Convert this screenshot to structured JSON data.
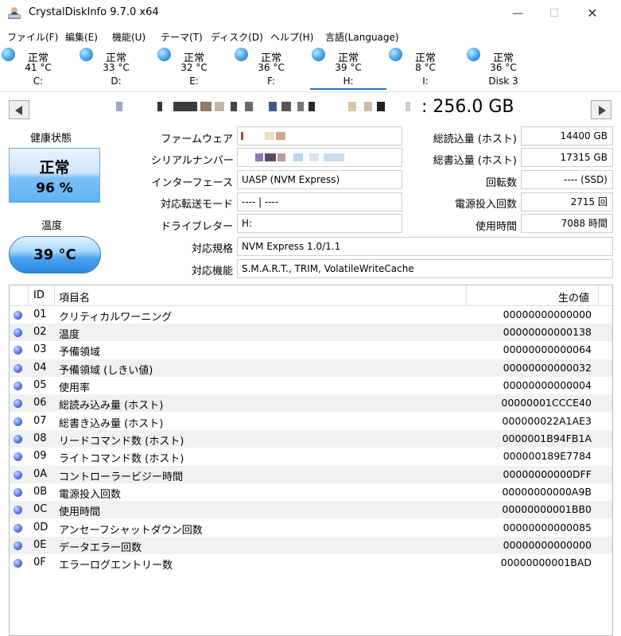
{
  "window": {
    "title": "CrystalDiskInfo 9.7.0 x64",
    "minimize": "—",
    "maximize": "☐",
    "close": "✕"
  },
  "menu": [
    "ファイル(F)",
    "編集(E)",
    "機能(U)",
    "テーマ(T)",
    "ディスク(D)",
    "ヘルプ(H)",
    "言語(Language)"
  ],
  "drives": [
    {
      "status": "正常",
      "temp": "41 °C",
      "letter": "C:"
    },
    {
      "status": "正常",
      "temp": "33 °C",
      "letter": "D:"
    },
    {
      "status": "正常",
      "temp": "32 °C",
      "letter": "E:"
    },
    {
      "status": "正常",
      "temp": "36 °C",
      "letter": "F:"
    },
    {
      "status": "正常",
      "temp": "39 °C",
      "letter": "H:"
    },
    {
      "status": "正常",
      "temp": "8 °C",
      "letter": "I:"
    },
    {
      "status": "正常",
      "temp": "36 °C",
      "letter": "Disk 3"
    }
  ],
  "model": {
    "capacity": ": 256.0 GB"
  },
  "health": {
    "label": "健康状態",
    "status": "正常",
    "percent": "96 %"
  },
  "temperature": {
    "label": "温度",
    "value": "39 °C"
  },
  "info": {
    "firmware_label": "ファームウェア",
    "serial_label": "シリアルナンバー",
    "interface_label": "インターフェース",
    "interface_value": "UASP (NVM Express)",
    "transfer_label": "対応転送モード",
    "transfer_value": "---- | ----",
    "drive_letter_label": "ドライブレター",
    "drive_letter_value": "H:",
    "standard_label": "対応規格",
    "standard_value": "NVM Express 1.0/1.1",
    "features_label": "対応機能",
    "features_value": "S.M.A.R.T., TRIM, VolatileWriteCache",
    "host_reads_label": "総読込量 (ホスト)",
    "host_reads_value": "14400 GB",
    "host_writes_label": "総書込量 (ホスト)",
    "host_writes_value": "17315 GB",
    "rotation_label": "回転数",
    "rotation_value": "---- (SSD)",
    "power_on_count_label": "電源投入回数",
    "power_on_count_value": "2715 回",
    "power_on_hours_label": "使用時間",
    "power_on_hours_value": "7088 時間"
  },
  "smart": {
    "headers": {
      "id": "ID",
      "name": "項目名",
      "raw": "生の値"
    },
    "rows": [
      {
        "id": "01",
        "name": "クリティカルワーニング",
        "raw": "00000000000000"
      },
      {
        "id": "02",
        "name": "温度",
        "raw": "00000000000138"
      },
      {
        "id": "03",
        "name": "予備領域",
        "raw": "00000000000064"
      },
      {
        "id": "04",
        "name": "予備領域 (しきい値)",
        "raw": "00000000000032"
      },
      {
        "id": "05",
        "name": "使用率",
        "raw": "00000000000004"
      },
      {
        "id": "06",
        "name": "総読み込み量 (ホスト)",
        "raw": "00000001CCCE40"
      },
      {
        "id": "07",
        "name": "総書き込み量 (ホスト)",
        "raw": "000000022A1AE3"
      },
      {
        "id": "08",
        "name": "リードコマンド数 (ホスト)",
        "raw": "0000001B94FB1A"
      },
      {
        "id": "09",
        "name": "ライトコマンド数 (ホスト)",
        "raw": "000000189E7784"
      },
      {
        "id": "0A",
        "name": "コントローラービジー時間",
        "raw": "00000000000DFF"
      },
      {
        "id": "0B",
        "name": "電源投入回数",
        "raw": "00000000000A9B"
      },
      {
        "id": "0C",
        "name": "使用時間",
        "raw": "00000000001BB0"
      },
      {
        "id": "0D",
        "name": "アンセーフシャットダウン回数",
        "raw": "00000000000085"
      },
      {
        "id": "0E",
        "name": "データエラー回数",
        "raw": "00000000000000"
      },
      {
        "id": "0F",
        "name": "エラーログエントリー数",
        "raw": "00000000001BAD"
      }
    ]
  }
}
